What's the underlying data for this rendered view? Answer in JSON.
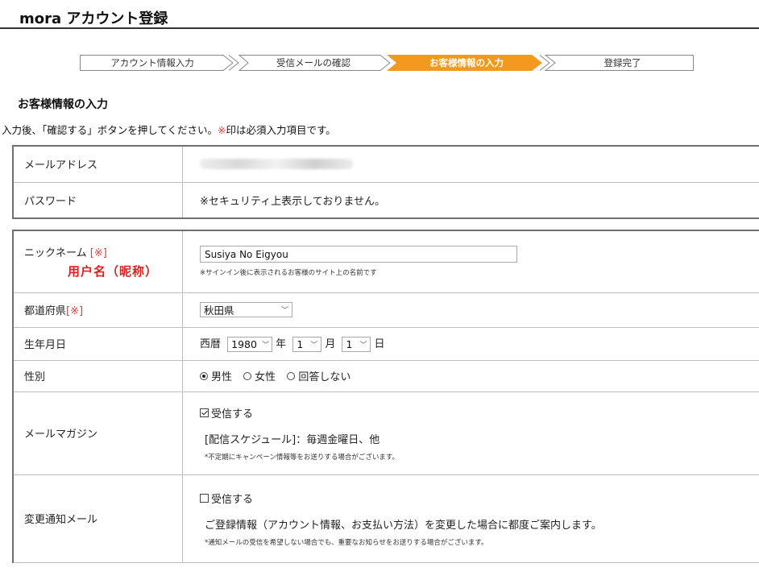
{
  "header": {
    "title": "mora アカウント登録"
  },
  "steps": [
    {
      "label": "アカウント情報入力",
      "active": false
    },
    {
      "label": "受信メールの確認",
      "active": false
    },
    {
      "label": "お客様情報の入力",
      "active": true
    },
    {
      "label": "登録完了",
      "active": false
    }
  ],
  "colors": {
    "active_step": "#f39a1e",
    "required_mark": "#e03b3b",
    "annotation": "#e02020"
  },
  "section_title": "お客様情報の入力",
  "instruction": {
    "before": "入力後、「確認する」ボタンを押してください。",
    "mark": "※",
    "after": "印は必須入力項目です。"
  },
  "account": {
    "email_label": "メールアドレス",
    "password_label": "パスワード",
    "password_value": "※セキュリティ上表示しておりません。"
  },
  "form": {
    "nickname": {
      "label": "ニックネーム",
      "required": "[※]",
      "annotation": "用户名（昵称）",
      "value": "Susiya No Eigyou",
      "note": "※サインイン後に表示されるお客様のサイト上の名前です"
    },
    "prefecture": {
      "label": "都道府県",
      "required": "[※]",
      "value": "秋田県"
    },
    "birthdate": {
      "label": "生年月日",
      "era": "西暦",
      "year": "1980",
      "year_unit": "年",
      "month": "1",
      "month_unit": "月",
      "day": "1",
      "day_unit": "日"
    },
    "gender": {
      "label": "性別",
      "options": [
        "男性",
        "女性",
        "回答しない"
      ],
      "selected": 0
    },
    "magazine": {
      "label": "メールマガジン",
      "check_label": "受信する",
      "checked": true,
      "schedule": "[配信スケジュール]：毎週金曜日、他",
      "note": "*不定期にキャンペーン情報等をお送りする場合がございます。"
    },
    "change_notice": {
      "label": "変更通知メール",
      "check_label": "受信する",
      "checked": false,
      "desc": "ご登録情報（アカウント情報、お支払い方法）を変更した場合に都度ご案内します。",
      "note": "*通知メールの受信を希望しない場合でも、重要なお知らせをお送りする場合がございます。"
    }
  }
}
